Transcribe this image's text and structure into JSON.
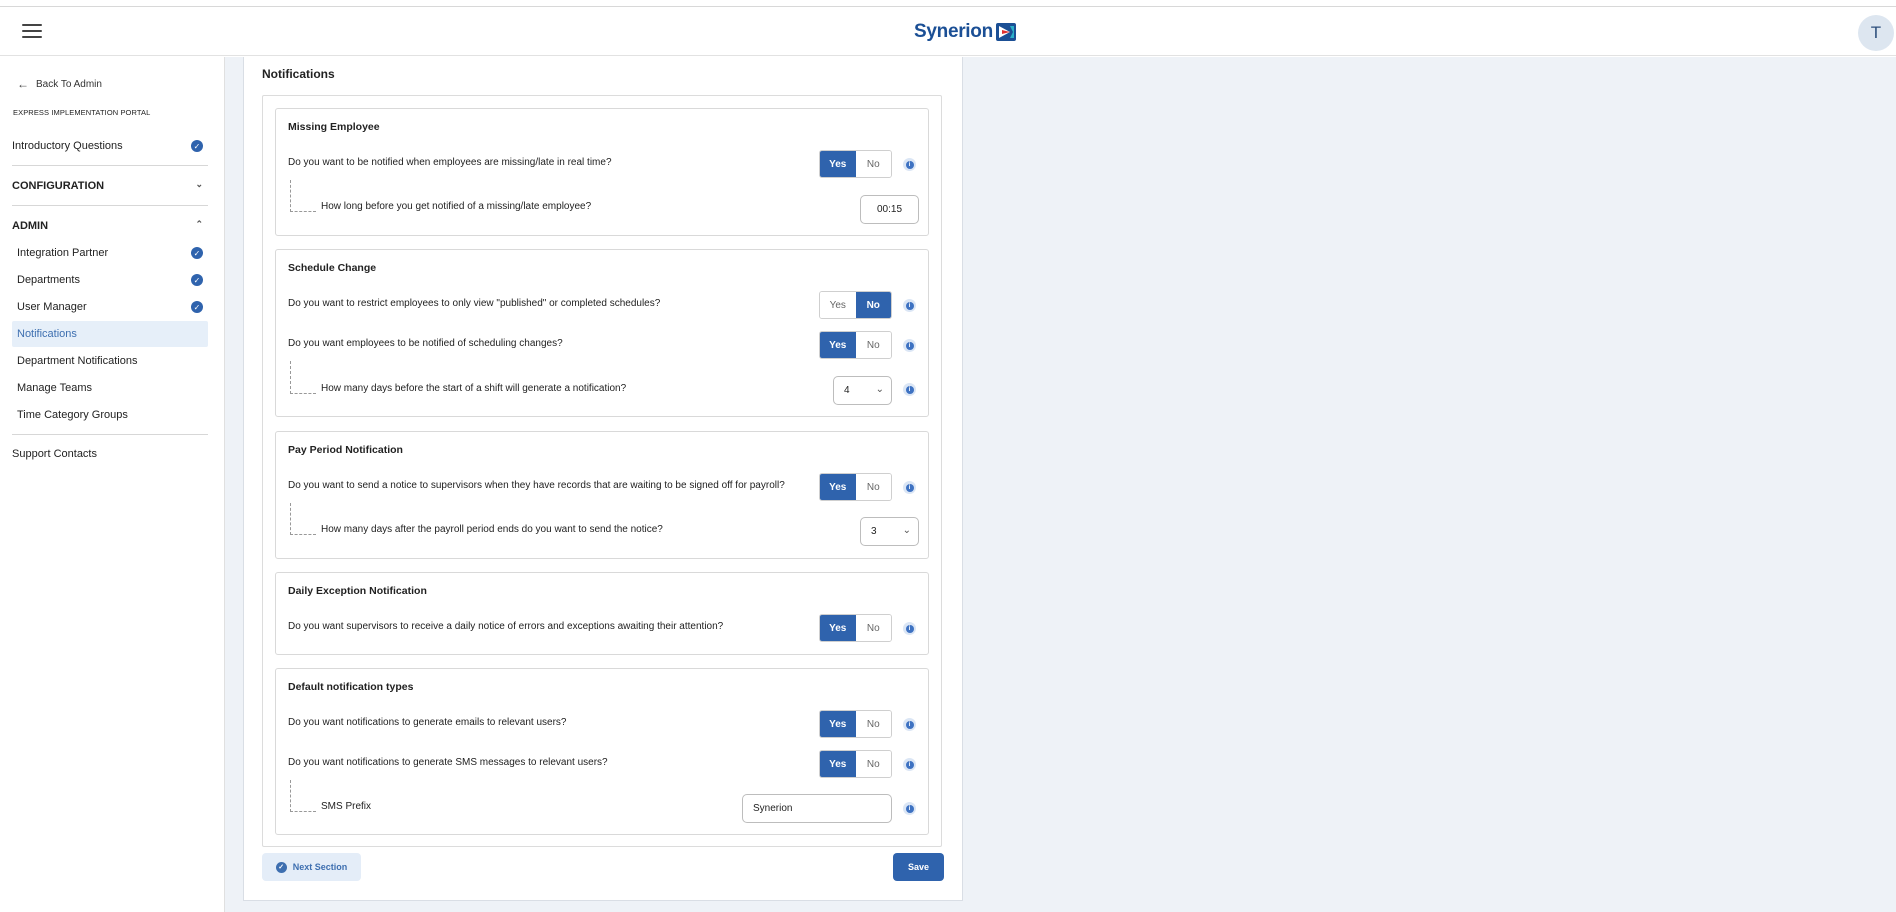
{
  "header": {
    "logo_text": "Synerion",
    "avatar_initial": "T"
  },
  "sidebar": {
    "back_label": "Back To Admin",
    "portal_label": "EXPRESS IMPLEMENTATION PORTAL",
    "intro": "Introductory Questions",
    "configuration": "CONFIGURATION",
    "admin": "ADMIN",
    "items": [
      {
        "label": "Integration Partner",
        "done": true
      },
      {
        "label": "Departments",
        "done": true
      },
      {
        "label": "User Manager",
        "done": true
      },
      {
        "label": "Notifications",
        "active": true
      },
      {
        "label": "Department Notifications"
      },
      {
        "label": "Manage Teams"
      },
      {
        "label": "Time Category Groups"
      }
    ],
    "support": "Support Contacts"
  },
  "main": {
    "title": "Notifications",
    "yes_label": "Yes",
    "no_label": "No",
    "sections": {
      "missing": {
        "title": "Missing Employee",
        "q1": "Do you want to be notified when employees are missing/late in real time?",
        "q1_answer": "Yes",
        "q2": "How long before you get notified of a missing/late employee?",
        "q2_value": "00:15"
      },
      "schedule": {
        "title": "Schedule Change",
        "q1": "Do you want to restrict employees to only view \"published\" or completed schedules?",
        "q1_answer": "No",
        "q2": "Do you want employees to be notified of scheduling changes?",
        "q2_answer": "Yes",
        "q3": "How many days before the start of a shift will generate a notification?",
        "q3_value": "4"
      },
      "payperiod": {
        "title": "Pay Period Notification",
        "q1": "Do you want to send a notice to supervisors when they have records that are waiting to be signed off for payroll?",
        "q1_answer": "Yes",
        "q2": "How many days after the payroll period ends do you want to send the notice?",
        "q2_value": "3"
      },
      "daily": {
        "title": "Daily Exception Notification",
        "q1": "Do you want supervisors to receive a daily notice of errors and exceptions awaiting their attention?",
        "q1_answer": "Yes"
      },
      "defaults": {
        "title": "Default notification types",
        "q1": "Do you want notifications to generate emails to relevant users?",
        "q1_answer": "Yes",
        "q2": "Do you want notifications to generate SMS messages to relevant users?",
        "q2_answer": "Yes",
        "q3": "SMS Prefix",
        "q3_value": "Synerion"
      }
    },
    "next_label": "Next Section",
    "save_label": "Save"
  }
}
